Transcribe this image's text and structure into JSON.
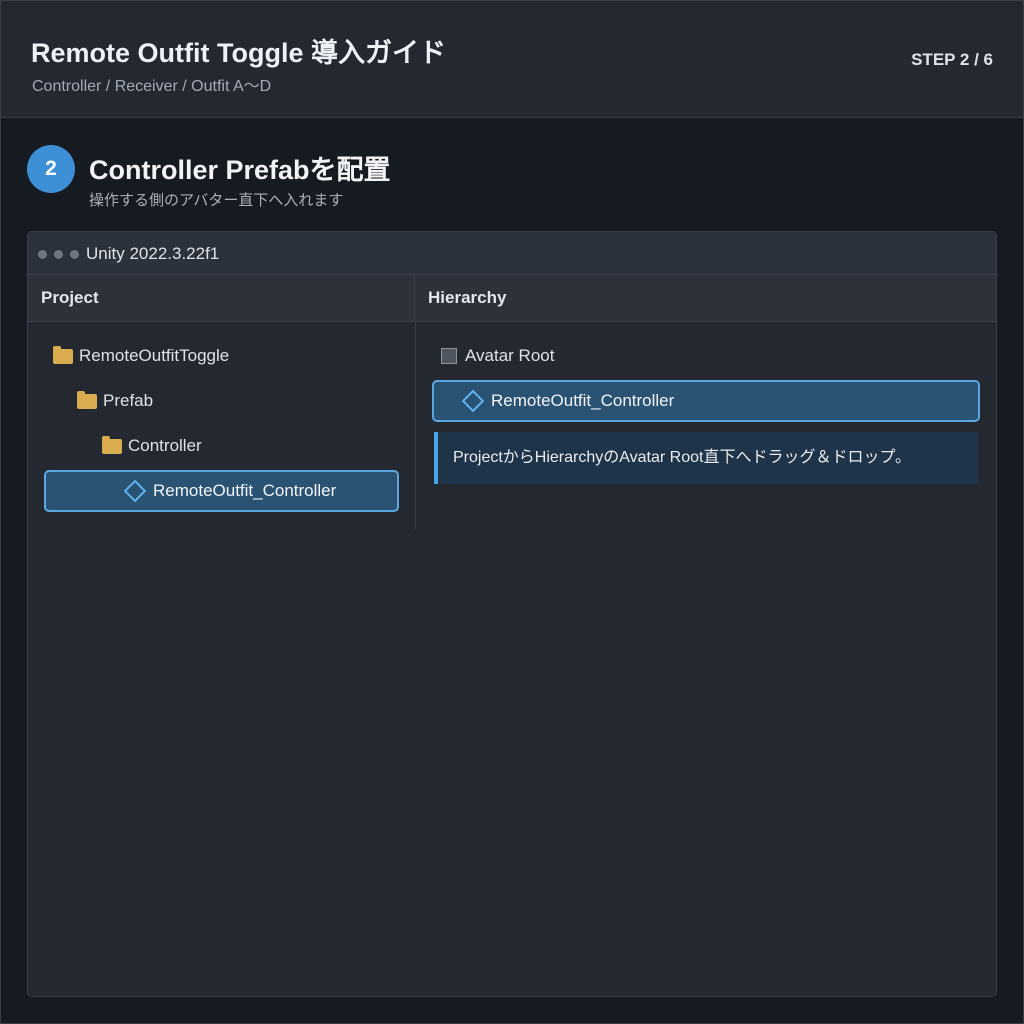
{
  "header": {
    "title": "Remote Outfit Toggle 導入ガイド",
    "subtitle": "Controller / Receiver / Outfit A〜D",
    "step_indicator": "STEP 2 / 6"
  },
  "step": {
    "number": "2",
    "title": "Controller Prefabを配置",
    "description": "操作する側のアバター直下へ入れます"
  },
  "window": {
    "title": "Unity 2022.3.22f1",
    "project_panel": {
      "label": "Project",
      "items": [
        {
          "label": "RemoteOutfitToggle",
          "icon": "folder-icon"
        },
        {
          "label": "Prefab",
          "icon": "folder-icon"
        },
        {
          "label": "Controller",
          "icon": "folder-icon"
        },
        {
          "label": "RemoteOutfit_Controller",
          "icon": "prefab-icon",
          "selected": true
        }
      ]
    },
    "hierarchy_panel": {
      "label": "Hierarchy",
      "items": [
        {
          "label": "Avatar Root",
          "icon": "gameobject-icon"
        },
        {
          "label": "RemoteOutfit_Controller",
          "icon": "prefab-icon",
          "selected": true
        }
      ],
      "note": "ProjectからHierarchyのAvatar Root直下へドラッグ＆ドロップ。"
    }
  },
  "colors": {
    "accent": "#3d8fd6",
    "selection_bg": "#2a5273",
    "selection_border": "#5aa8e2",
    "folder": "#d9ad4f"
  }
}
